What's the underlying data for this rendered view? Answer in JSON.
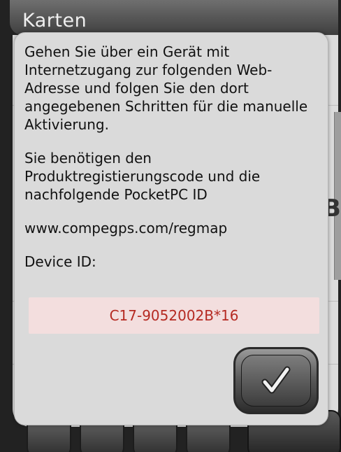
{
  "app": {
    "title": "Karten",
    "side_glyph": "B"
  },
  "dialog": {
    "paragraph1": "Gehen Sie über ein Gerät mit Internetzugang zur folgenden Web-Adresse und folgen Sie den dort angegebenen Schritten für die manuelle Aktivierung.",
    "paragraph2": "Sie benötigen den Produktregistierungscode und die nachfolgende PocketPC ID",
    "url": "www.compegps.com/regmap",
    "device_id_label": "Device ID:",
    "device_id_value": "C17-9052002B*16",
    "ok_icon": "check-icon"
  },
  "colors": {
    "device_id_text": "#b52a22",
    "device_id_background": "#f3dede",
    "dialog_background": "#dadada"
  }
}
